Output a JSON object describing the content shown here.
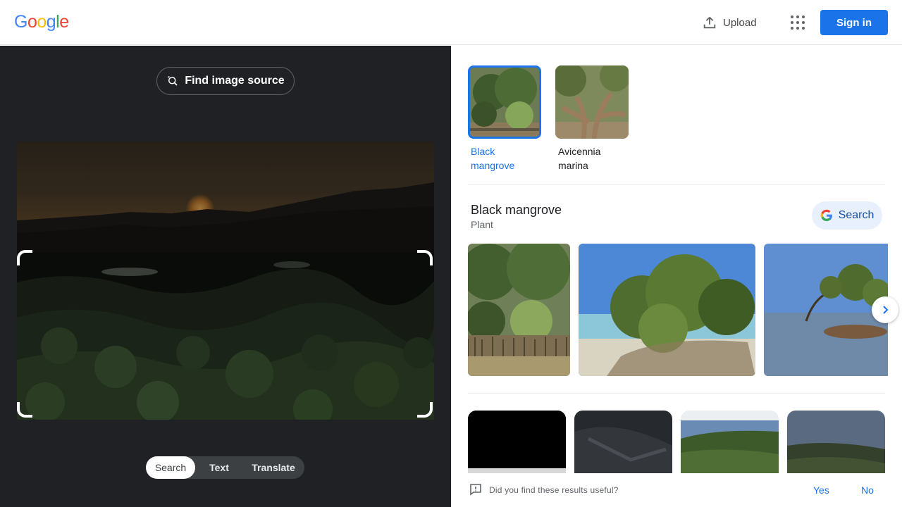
{
  "header": {
    "logo": [
      "G",
      "o",
      "o",
      "g",
      "l",
      "e"
    ],
    "logo_colors": [
      "#4285f4",
      "#ea4335",
      "#fbbc05",
      "#4285f4",
      "#34a853",
      "#ea4335"
    ],
    "upload_label": "Upload",
    "signin_label": "Sign in"
  },
  "left": {
    "find_source_label": "Find image source",
    "modes": [
      "Search",
      "Text",
      "Translate"
    ],
    "active_mode": "Search"
  },
  "candidates": [
    {
      "line1": "Black",
      "line2": "mangrove",
      "selected": true
    },
    {
      "line1": "Avicennia",
      "line2": "marina",
      "selected": false
    }
  ],
  "knowledge": {
    "title": "Black mangrove",
    "subtitle": "Plant",
    "search_label": "Search"
  },
  "feedback": {
    "question": "Did you find these results useful?",
    "yes": "Yes",
    "no": "No"
  },
  "colors": {
    "accent": "#1a73e8",
    "dark_bg": "#202124"
  }
}
